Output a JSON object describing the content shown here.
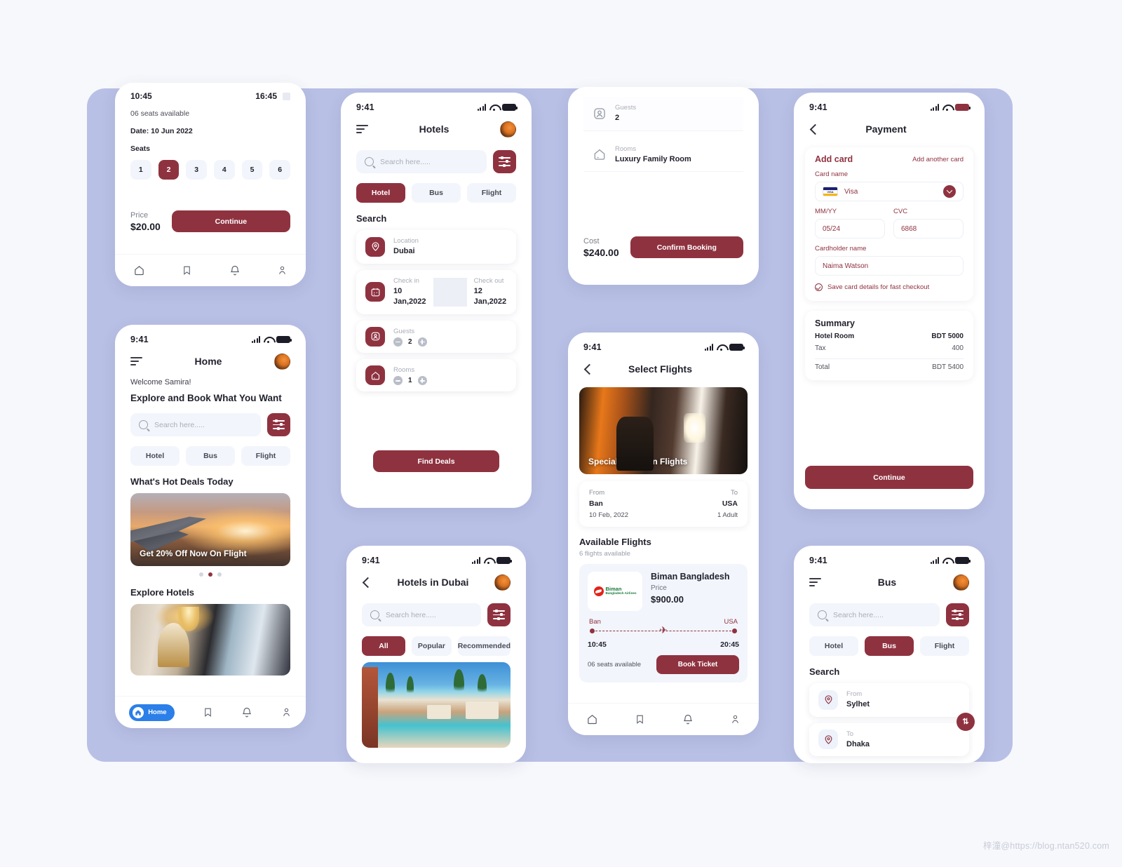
{
  "watermark": "梓潼@https://blog.ntan520.com",
  "colors": {
    "accent": "#8f3240",
    "surface": "#ffffff",
    "board": "#b9c0e6",
    "chipBg": "#f2f5fb",
    "page": "#f7f8fc"
  },
  "common": {
    "search_placeholder": "Search here.....",
    "status_time": "9:41",
    "icons": {
      "hamburger": "hamburger-icon",
      "filter": "filter-sliders-icon",
      "search": "search-icon",
      "avatar": "avatar",
      "back": "back-chevron-icon"
    },
    "tabbar": [
      {
        "name": "home",
        "label": "Home"
      },
      {
        "name": "bookmark",
        "label": ""
      },
      {
        "name": "bell",
        "label": ""
      },
      {
        "name": "profile",
        "label": ""
      }
    ]
  },
  "screens": {
    "seats": {
      "depart_time": "10:45",
      "arrive_time": "16:45",
      "seats_available": "06 seats available",
      "date": "Date: 10 Jun 2022",
      "seats_label": "Seats",
      "seat_numbers": [
        "1",
        "2",
        "3",
        "4",
        "5",
        "6"
      ],
      "selected_seat": "2",
      "price_label": "Price",
      "price_value": "$20.00",
      "continue_label": "Continue"
    },
    "home": {
      "status_time": "9:41",
      "title": "Home",
      "welcome": "Welcome Samira!",
      "headline": "Explore and Book What You Want",
      "tabs": [
        {
          "label": "Hotel",
          "active": false
        },
        {
          "label": "Bus",
          "active": false
        },
        {
          "label": "Flight",
          "active": false
        }
      ],
      "deals_title": "What's Hot Deals Today",
      "deal_caption": "Get 20% Off Now On Flight",
      "carousel_dots": 3,
      "carousel_active_index": 1,
      "explore_title": "Explore Hotels",
      "bottom_home_label": "Home"
    },
    "hotels": {
      "status_time": "9:41",
      "title": "Hotels",
      "tabs": [
        {
          "label": "Hotel",
          "active": true
        },
        {
          "label": "Bus",
          "active": false
        },
        {
          "label": "Flight",
          "active": false
        }
      ],
      "search_title": "Search",
      "location_label": "Location",
      "location_value": "Dubai",
      "checkin_label": "Check in",
      "checkin_value": "10 Jan,2022",
      "checkout_label": "Check out",
      "checkout_value": "12 Jan,2022",
      "guests_label": "Guests",
      "guests_value": "2",
      "rooms_label": "Rooms",
      "rooms_value": "1",
      "find_deals_label": "Find Deals"
    },
    "hotels_in_dubai": {
      "status_time": "9:41",
      "title": "Hotels in Dubai",
      "tabs": [
        {
          "label": "All",
          "active": true
        },
        {
          "label": "Popular",
          "active": false
        },
        {
          "label": "Recommended",
          "active": false
        }
      ]
    },
    "booking": {
      "guests_label": "Guests",
      "guests_value": "2",
      "rooms_label": "Rooms",
      "rooms_value": "Luxury Family Room",
      "cost_label": "Cost",
      "cost_value": "$240.00",
      "confirm_label": "Confirm Booking"
    },
    "select_flights": {
      "status_time": "9:41",
      "title": "Select Flights",
      "banner_caption": "Special Offers on Flights",
      "from_label": "From",
      "from_value": "Ban",
      "from_date": "10 Feb, 2022",
      "to_label": "To",
      "to_value": "USA",
      "to_sub": "1 Adult",
      "available_title": "Available Flights",
      "available_sub": "6 flights available",
      "flight": {
        "airline": "Biman Bangladesh",
        "logo_name": "Biman",
        "logo_sub": "Bangladesh Airlines",
        "price_label": "Price",
        "price_value": "$900.00",
        "origin": "Ban",
        "destination": "USA",
        "depart_time": "10:45",
        "arrive_time": "20:45",
        "seats": "06 seats available",
        "book_label": "Book Ticket"
      }
    },
    "payment": {
      "status_time": "9:41",
      "title": "Payment",
      "add_card_title": "Add card",
      "add_another": "Add another card",
      "card_name_label": "Card name",
      "card_name_value": "Visa",
      "mmyy_label": "MM/YY",
      "mmyy_value": "05/24",
      "cvc_label": "CVC",
      "cvc_value": "6868",
      "cardholder_label": "Cardholder name",
      "cardholder_value": "Naima Watson",
      "save_label": "Save card details for fast checkout",
      "summary_title": "Summary",
      "rows": [
        {
          "label": "Hotel Room",
          "value": "BDT 5000",
          "bold": true
        },
        {
          "label": "Tax",
          "value": "400",
          "bold": false
        }
      ],
      "total_label": "Total",
      "total_value": "BDT 5400",
      "continue_label": "Continue"
    },
    "bus": {
      "status_time": "9:41",
      "title": "Bus",
      "tabs": [
        {
          "label": "Hotel",
          "active": false
        },
        {
          "label": "Bus",
          "active": true
        },
        {
          "label": "Flight",
          "active": false
        }
      ],
      "search_title": "Search",
      "from_label": "From",
      "from_value": "Sylhet",
      "to_label": "To",
      "to_value": "Dhaka",
      "swap_icon": "⇅"
    }
  }
}
